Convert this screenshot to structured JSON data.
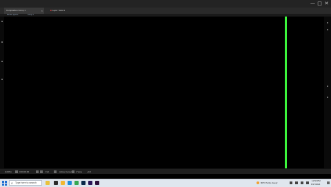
{
  "titlebar": {
    "controls": {
      "minimize": "—",
      "maximize": "□",
      "close": "✕"
    }
  },
  "tabs": [
    {
      "label": "Composition Comp 1",
      "close": "×"
    },
    {
      "label": "Layer: Solid 1"
    }
  ],
  "panel_tabs": [
    {
      "label": "Render Queue"
    },
    {
      "label": "Comp 1"
    }
  ],
  "status": {
    "zoom": "(100%)",
    "time": "0;00;00;00",
    "view": "Full",
    "camera": "Active Camera",
    "views": "1 View",
    "offset": "+0.0"
  },
  "taskbar": {
    "search_placeholder": "Type here to search",
    "weather": "80°F  Partly cloudy",
    "time": "11:56 PM",
    "date": "6/17/2024",
    "apps": [
      {
        "name": "task-view",
        "color": "#2b2b2b"
      },
      {
        "name": "file-explorer",
        "color": "#f2b731"
      },
      {
        "name": "edge",
        "color": "#1b8ad8"
      },
      {
        "name": "chrome",
        "color": "#35a853"
      },
      {
        "name": "photoshop",
        "color": "#0b2a4a"
      },
      {
        "name": "after-effects",
        "color": "#2a1558"
      },
      {
        "name": "premiere",
        "color": "#2c0f3a"
      }
    ]
  },
  "accent": {
    "playhead": "#3cf53c"
  }
}
